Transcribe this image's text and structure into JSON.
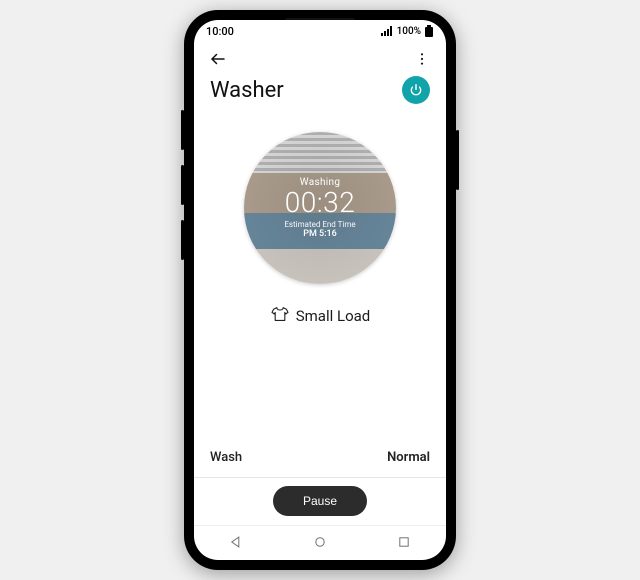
{
  "status": {
    "time": "10:00",
    "battery": "100%"
  },
  "header": {
    "title": "Washer"
  },
  "colors": {
    "accent": "#11a3aa",
    "action": "#2c2c2c"
  },
  "cycle": {
    "status": "Washing",
    "remaining": "00:32",
    "est_label": "Estimated End Time",
    "est_time": "PM 5:16"
  },
  "load": {
    "icon": "shirt-icon",
    "label": "Small Load"
  },
  "mode": {
    "type": "Wash",
    "value": "Normal"
  },
  "action": {
    "label": "Pause"
  }
}
